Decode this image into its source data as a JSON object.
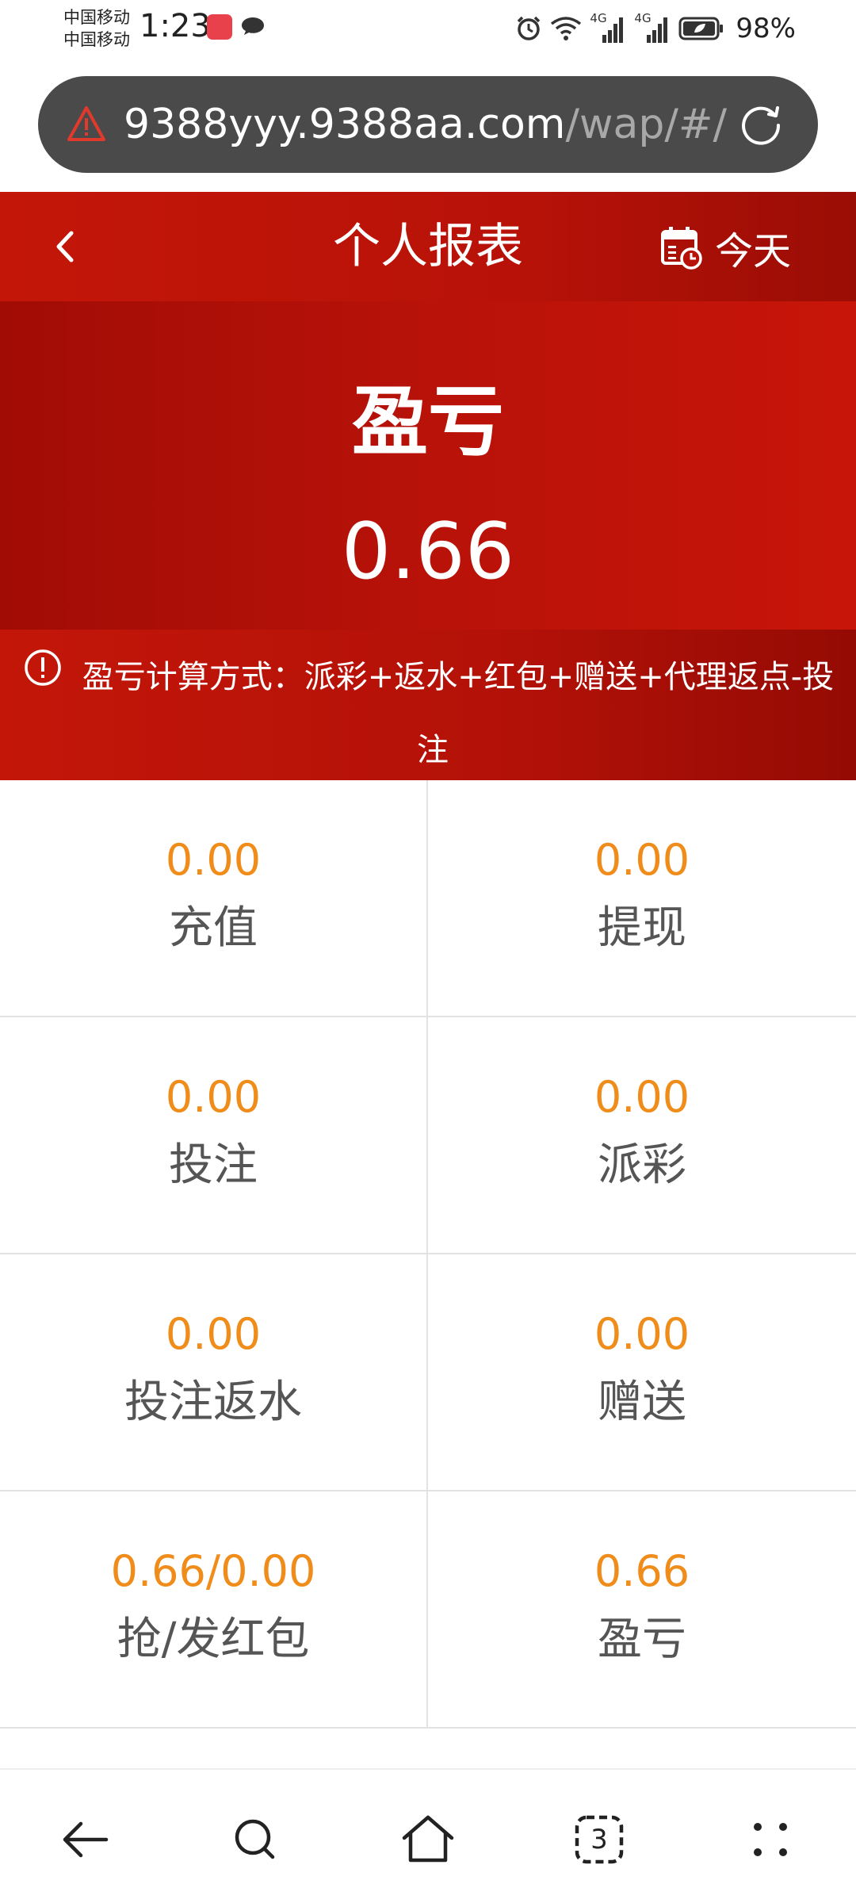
{
  "status_bar": {
    "carrier_1": "中国移动",
    "carrier_2": "中国移动",
    "time": "1:23",
    "signal_1": "4G",
    "signal_2": "4G",
    "battery": "98%"
  },
  "browser": {
    "url_host": "9388yyy.9388aa.com",
    "url_path": "/wap/#/",
    "icons": [
      "warning-icon",
      "reload-icon"
    ]
  },
  "header": {
    "title": "个人报表",
    "date_filter": "今天",
    "icons": [
      "back-arrow-icon",
      "calendar-icon"
    ]
  },
  "summary": {
    "label": "盈亏",
    "value": "0.66"
  },
  "formula_note": {
    "text": "盈亏计算方式：派彩+返水+红包+赠送+代理返点-投注",
    "icon": "info-circle-icon"
  },
  "stats": [
    {
      "value": "0.00",
      "label": "充值"
    },
    {
      "value": "0.00",
      "label": "提现"
    },
    {
      "value": "0.00",
      "label": "投注"
    },
    {
      "value": "0.00",
      "label": "派彩"
    },
    {
      "value": "0.00",
      "label": "投注返水"
    },
    {
      "value": "0.00",
      "label": "赠送"
    },
    {
      "value": "0.66/0.00",
      "label": "抢/发红包"
    },
    {
      "value": "0.66",
      "label": "盈亏"
    }
  ],
  "bottom_nav": {
    "tabs_count": "3",
    "icons": [
      "back-icon",
      "search-icon",
      "home-icon",
      "tabs-icon",
      "more-icon"
    ]
  },
  "colors": {
    "header_red": "#c31609",
    "value_orange": "#ef8c1a",
    "url_bar_bg": "#4a4a4a"
  }
}
